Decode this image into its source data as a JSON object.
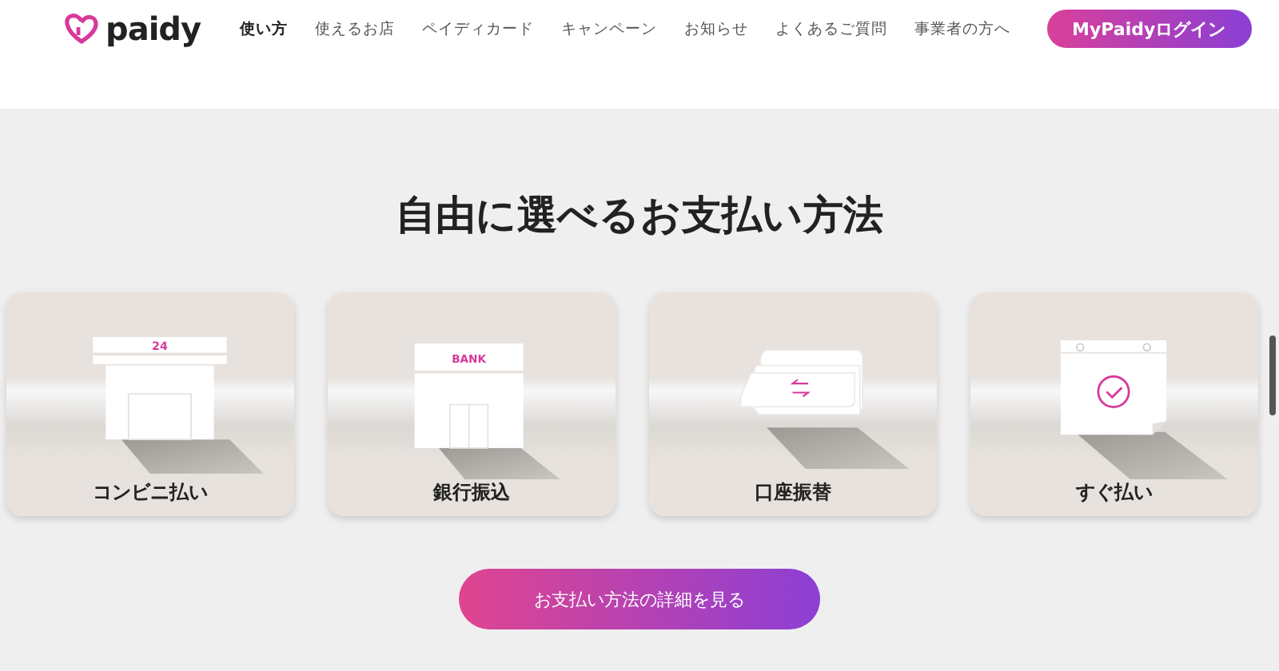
{
  "header": {
    "logo": "paidy",
    "nav": [
      {
        "label": "使い方",
        "selected": true
      },
      {
        "label": "使えるお店",
        "selected": false
      },
      {
        "label": "ペイディカード",
        "selected": false
      },
      {
        "label": "キャンペーン",
        "selected": false
      },
      {
        "label": "お知らせ",
        "selected": false
      },
      {
        "label": "よくあるご質問",
        "selected": false
      },
      {
        "label": "事業者の方へ",
        "selected": false
      }
    ],
    "login_button": "MyPaidyログイン"
  },
  "section": {
    "title": "自由に選べるお支払い方法",
    "methods": [
      {
        "kind": "store",
        "sign": "24",
        "label": "コンビニ払い"
      },
      {
        "kind": "bank",
        "sign": "BANK",
        "label": "銀行振込"
      },
      {
        "kind": "transfer",
        "label": "口座振替"
      },
      {
        "kind": "calendar",
        "label": "すぐ払い"
      }
    ],
    "details_button": "お支払い方法の詳細を見る"
  }
}
